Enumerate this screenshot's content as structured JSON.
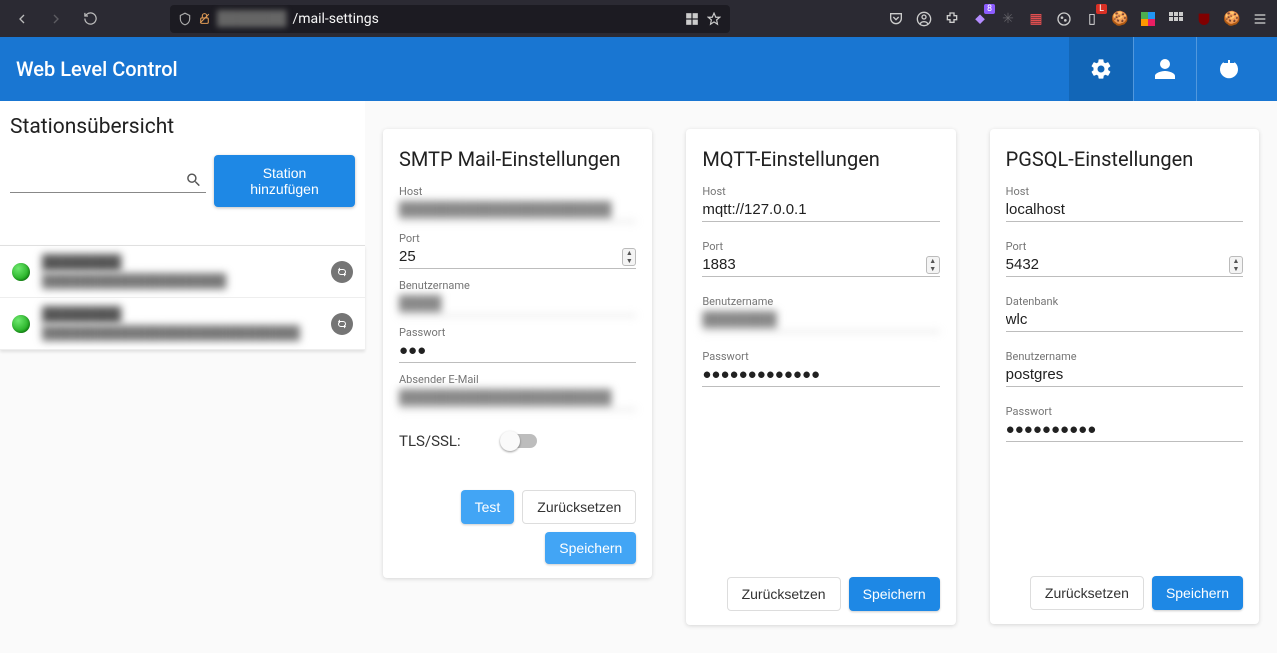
{
  "browser": {
    "url_hidden": "███████",
    "url_path": "/mail-settings",
    "ext_badge": "8",
    "ext_badge_l": "L"
  },
  "header": {
    "title": "Web Level Control"
  },
  "sidebar": {
    "title": "Stationsübersicht",
    "add_label": "Station hinzufügen",
    "stations": [
      {
        "name": "████████",
        "addr": "████████████████████"
      },
      {
        "name": "████████",
        "addr": "████████████████████████████"
      }
    ]
  },
  "cards": {
    "smtp": {
      "title": "SMTP Mail-Einstellungen",
      "host_label": "Host",
      "host_val": "████████████████████",
      "port_label": "Port",
      "port_val": "25",
      "user_label": "Benutzername",
      "user_val": "████",
      "pass_label": "Passwort",
      "pass_val": "●●●",
      "sender_label": "Absender E-Mail",
      "sender_val": "████████████████████",
      "tls_label": "TLS/SSL:",
      "test_label": "Test",
      "reset_label": "Zurücksetzen",
      "save_label": "Speichern"
    },
    "mqtt": {
      "title": "MQTT-Einstellungen",
      "host_label": "Host",
      "host_val": "mqtt://127.0.0.1",
      "port_label": "Port",
      "port_val": "1883",
      "user_label": "Benutzername",
      "user_val": "███████",
      "pass_label": "Passwort",
      "pass_val": "●●●●●●●●●●●●●",
      "reset_label": "Zurücksetzen",
      "save_label": "Speichern"
    },
    "pgsql": {
      "title": "PGSQL-Einstellungen",
      "host_label": "Host",
      "host_val": "localhost",
      "port_label": "Port",
      "port_val": "5432",
      "db_label": "Datenbank",
      "db_val": "wlc",
      "user_label": "Benutzername",
      "user_val": "postgres",
      "pass_label": "Passwort",
      "pass_val": "●●●●●●●●●●",
      "reset_label": "Zurücksetzen",
      "save_label": "Speichern"
    }
  }
}
